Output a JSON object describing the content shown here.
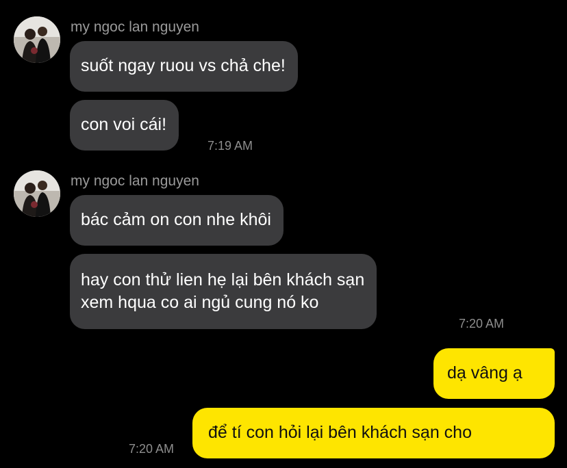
{
  "colors": {
    "background": "#000000",
    "incoming_bubble": "#3b3b3d",
    "outgoing_bubble": "#fee500",
    "sender_name": "#9a9a9a",
    "timestamp": "#8e8e8e"
  },
  "groups": [
    {
      "sender": "my ngoc lan nguyen",
      "avatar_icon": "profile-photo-icon",
      "messages": [
        "suốt ngay ruou vs chả che!",
        "con voi cái!"
      ],
      "time": "7:19 AM"
    },
    {
      "sender": "my ngoc lan nguyen",
      "avatar_icon": "profile-photo-icon",
      "messages": [
        "bác cảm on con nhe khôi",
        "hay con thử lien hẹ lại bên khách sạn",
        "xem hqua co ai ngủ cung nó ko"
      ],
      "time": "7:20 AM"
    }
  ],
  "outgoing": {
    "messages": [
      "dạ vâng ạ",
      "để tí con hỏi lại bên khách sạn cho"
    ],
    "time": "7:20 AM"
  }
}
